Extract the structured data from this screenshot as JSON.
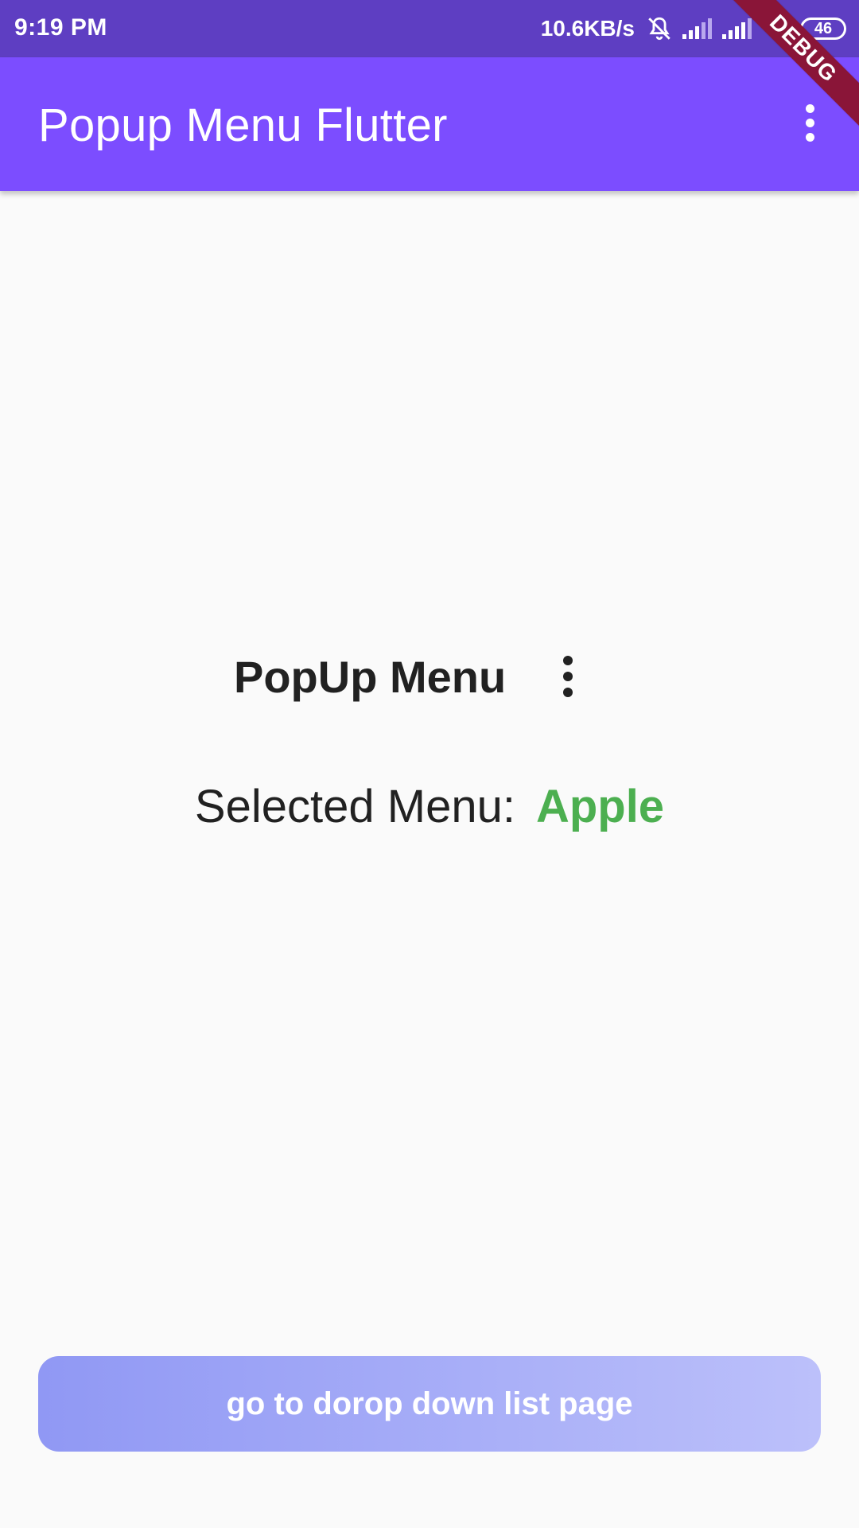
{
  "status_bar": {
    "time": "9:19 PM",
    "net_speed": "10.6KB/s",
    "battery_level": "46",
    "icons": [
      "bell-off-icon",
      "signal-icon",
      "signal-icon",
      "wifi-icon",
      "battery-icon"
    ]
  },
  "app_bar": {
    "title": "Popup Menu Flutter",
    "menu_icon": "more-vert-icon",
    "color": "#7c4dff"
  },
  "debug_banner": {
    "label": "DEBUG"
  },
  "main": {
    "popup_label": "PopUp Menu",
    "popup_icon": "more-vert-icon",
    "selected_label": "Selected Menu:",
    "selected_value": "Apple",
    "selected_value_color": "#4caf50"
  },
  "bottom_button": {
    "label": "go to dorop down list page"
  }
}
